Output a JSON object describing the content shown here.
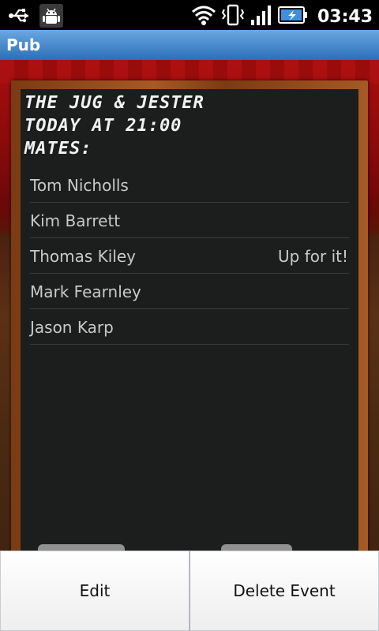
{
  "status_bar": {
    "time": "03:43",
    "icons": [
      "usb-icon",
      "android-debug-icon",
      "wifi-icon",
      "vibrate-icon",
      "signal-icon",
      "battery-charging-icon"
    ]
  },
  "title_bar": {
    "title": "Pub"
  },
  "event": {
    "venue": "The Jug & Jester",
    "when": "Today at 21:00",
    "mates_label": "Mates:"
  },
  "mates": [
    {
      "name": "Tom Nicholls",
      "status": ""
    },
    {
      "name": "Kim Barrett",
      "status": ""
    },
    {
      "name": "Thomas Kiley",
      "status": "Up for it!"
    },
    {
      "name": "Mark Fearnley",
      "status": ""
    },
    {
      "name": "Jason Karp",
      "status": ""
    }
  ],
  "actions": {
    "edit_label": "Edit",
    "delete_label": "Delete Event"
  },
  "colors": {
    "title_bar": "#2c6fb8",
    "chalkboard": "#1b1e1c",
    "curtain": "#a80d0d"
  }
}
